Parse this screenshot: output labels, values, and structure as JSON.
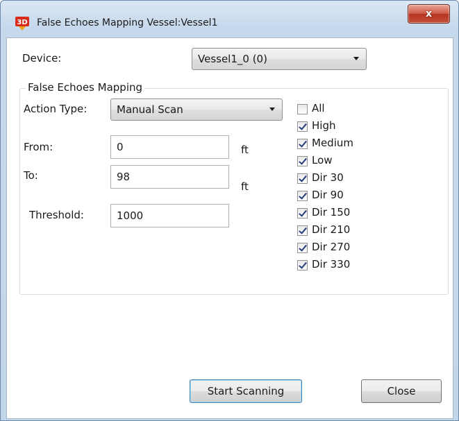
{
  "window": {
    "title": "False Echoes Mapping Vessel:Vessel1",
    "close_glyph": "x",
    "app_icon": "3d-app-icon"
  },
  "device": {
    "label": "Device:",
    "value": "Vessel1_0 (0)"
  },
  "group": {
    "title": "False Echoes Mapping",
    "action_type": {
      "label": "Action Type:",
      "value": "Manual Scan"
    },
    "from": {
      "label": "From:",
      "value": "0",
      "unit": "ft"
    },
    "to": {
      "label": "To:",
      "value": "98",
      "unit": "ft"
    },
    "threshold": {
      "label": "Threshold:",
      "value": "1000"
    },
    "checkboxes": [
      {
        "label": "All",
        "checked": false
      },
      {
        "label": "High",
        "checked": true
      },
      {
        "label": "Medium",
        "checked": true
      },
      {
        "label": "Low",
        "checked": true
      },
      {
        "label": "Dir 30",
        "checked": true
      },
      {
        "label": "Dir 90",
        "checked": true
      },
      {
        "label": "Dir 150",
        "checked": true
      },
      {
        "label": "Dir 210",
        "checked": true
      },
      {
        "label": "Dir 270",
        "checked": true
      },
      {
        "label": "Dir 330",
        "checked": true
      }
    ]
  },
  "buttons": {
    "start": "Start Scanning",
    "close": "Close"
  },
  "colors": {
    "check_mark": "#233c7a",
    "default_button_border": "#3c7fb1",
    "close_button": "#c45036"
  }
}
